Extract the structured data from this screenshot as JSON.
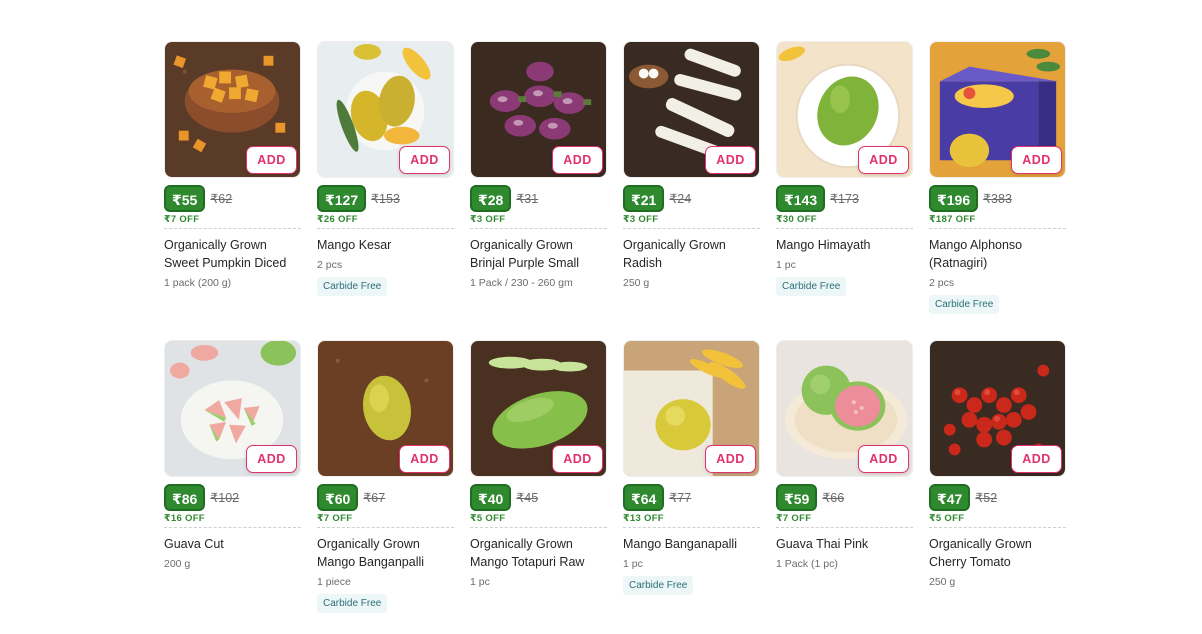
{
  "products": [
    {
      "price": "₹55",
      "mrp": "₹62",
      "discount": "₹7 OFF",
      "name": "Organically Grown Sweet Pumpkin Diced",
      "qty": "1 pack (200 g)",
      "tag": "",
      "add_label": "ADD",
      "image": "pumpkin-diced"
    },
    {
      "price": "₹127",
      "mrp": "₹153",
      "discount": "₹26 OFF",
      "name": "Mango Kesar",
      "qty": "2 pcs",
      "tag": "Carbide Free",
      "add_label": "ADD",
      "image": "mango-kesar"
    },
    {
      "price": "₹28",
      "mrp": "₹31",
      "discount": "₹3 OFF",
      "name": "Organically Grown Brinjal Purple Small",
      "qty": "1 Pack / 230 - 260 gm",
      "tag": "",
      "add_label": "ADD",
      "image": "brinjal"
    },
    {
      "price": "₹21",
      "mrp": "₹24",
      "discount": "₹3 OFF",
      "name": "Organically Grown Radish",
      "qty": "250 g",
      "tag": "",
      "add_label": "ADD",
      "image": "radish"
    },
    {
      "price": "₹143",
      "mrp": "₹173",
      "discount": "₹30 OFF",
      "name": "Mango Himayath",
      "qty": "1 pc",
      "tag": "Carbide Free",
      "add_label": "ADD",
      "image": "mango-plate"
    },
    {
      "price": "₹196",
      "mrp": "₹383",
      "discount": "₹187 OFF",
      "name": "Mango Alphonso (Ratnagiri)",
      "qty": "2 pcs",
      "tag": "Carbide Free",
      "add_label": "ADD",
      "image": "alphonso-box"
    },
    {
      "price": "₹86",
      "mrp": "₹102",
      "discount": "₹16 OFF",
      "name": "Guava Cut",
      "qty": "200 g",
      "tag": "",
      "add_label": "ADD",
      "image": "guava-cut"
    },
    {
      "price": "₹60",
      "mrp": "₹67",
      "discount": "₹7 OFF",
      "name": "Organically Grown Mango Banganpalli",
      "qty": "1 piece",
      "tag": "Carbide Free",
      "add_label": "ADD",
      "image": "mango-soil"
    },
    {
      "price": "₹40",
      "mrp": "₹45",
      "discount": "₹5 OFF",
      "name": "Organically Grown Mango Totapuri Raw",
      "qty": "1 pc",
      "tag": "",
      "add_label": "ADD",
      "image": "mango-raw"
    },
    {
      "price": "₹64",
      "mrp": "₹77",
      "discount": "₹13 OFF",
      "name": "Mango Banganapalli",
      "qty": "1 pc",
      "tag": "Carbide Free",
      "add_label": "ADD",
      "image": "mango-cloth"
    },
    {
      "price": "₹59",
      "mrp": "₹66",
      "discount": "₹7 OFF",
      "name": "Guava Thai Pink",
      "qty": "1 Pack (1 pc)",
      "tag": "",
      "add_label": "ADD",
      "image": "guava-pink"
    },
    {
      "price": "₹47",
      "mrp": "₹52",
      "discount": "₹5 OFF",
      "name": "Organically Grown Cherry Tomato",
      "qty": "250 g",
      "tag": "",
      "add_label": "ADD",
      "image": "cherry-tomato"
    }
  ],
  "colors": {
    "price_bg": "#2f8a2f",
    "add_accent": "#e0336e",
    "discount": "#2f8a2f",
    "tag_bg": "#eef7f8",
    "tag_text": "#2a6f78"
  }
}
